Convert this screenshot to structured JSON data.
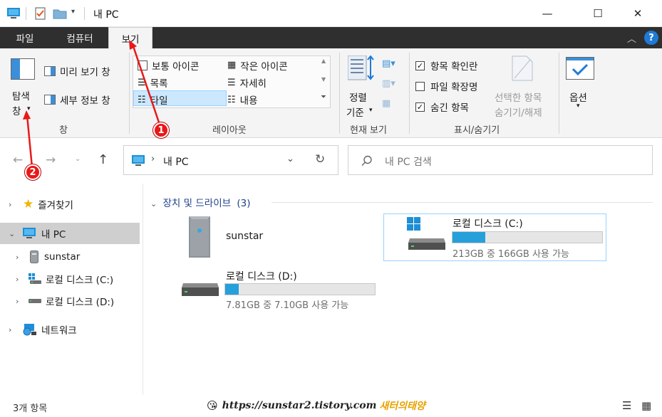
{
  "window": {
    "title": "내 PC",
    "minimize_glyph": "—",
    "maximize_glyph": "☐",
    "close_glyph": "✕"
  },
  "ribbon_tabs": [
    {
      "label": "파일"
    },
    {
      "label": "컴퓨터"
    },
    {
      "label": "보기"
    }
  ],
  "help_glyph": "?",
  "ribbon": {
    "pane_group": {
      "nav_pane_label_1": "탐색",
      "nav_pane_label_2": "창",
      "preview_pane": "미리 보기 창",
      "details_pane": "세부 정보 창",
      "group_label": "창"
    },
    "layout_group": {
      "items": [
        "보통 아이콘",
        "작은 아이콘",
        "목록",
        "자세히",
        "타일",
        "내용"
      ],
      "group_label": "레이아웃"
    },
    "current_view_group": {
      "sort_label_1": "정렬",
      "sort_label_2": "기준",
      "group_label": "현재 보기"
    },
    "show_hide_group": {
      "item_checkboxes": "항목 확인란",
      "file_extensions": "파일 확장명",
      "hidden_items": "숨긴 항목",
      "hide_selected_1": "선택한 항목",
      "hide_selected_2": "숨기기/해제",
      "group_label": "표시/숨기기",
      "item_checkboxes_checked": true,
      "file_extensions_checked": false,
      "hidden_items_checked": true
    },
    "options": {
      "label": "옵션"
    }
  },
  "address": {
    "breadcrumb_sep": "›",
    "location": "내 PC"
  },
  "search": {
    "placeholder": "내 PC 검색"
  },
  "nav_pane": {
    "items": [
      {
        "label": "즐겨찾기"
      },
      {
        "label": "내 PC"
      },
      {
        "label": "sunstar"
      },
      {
        "label": "로컬 디스크 (C:)"
      },
      {
        "label": "로컬 디스크 (D:)"
      },
      {
        "label": "네트워크"
      }
    ]
  },
  "content": {
    "group_title": "장치 및 드라이브",
    "group_count": "(3)",
    "items": [
      {
        "name": "sunstar"
      },
      {
        "name": "로컬 디스크 (C:)",
        "space": "213GB 중 166GB 사용 가능",
        "used_fraction": 0.22
      },
      {
        "name": "로컬 디스크 (D:)",
        "space": "7.81GB 중 7.10GB 사용 가능",
        "used_fraction": 0.09
      }
    ]
  },
  "status": {
    "item_count": "3개 항목"
  },
  "watermark": {
    "text": "https://sunstar2.tistory.com",
    "brand": "새터의태양"
  },
  "annotations": [
    {
      "number": "1"
    },
    {
      "number": "2"
    }
  ],
  "colors": {
    "accent": "#26a0da",
    "annotation_red": "#e81919",
    "selection": "#cce8ff",
    "tab_dark": "#2f2f2f"
  }
}
